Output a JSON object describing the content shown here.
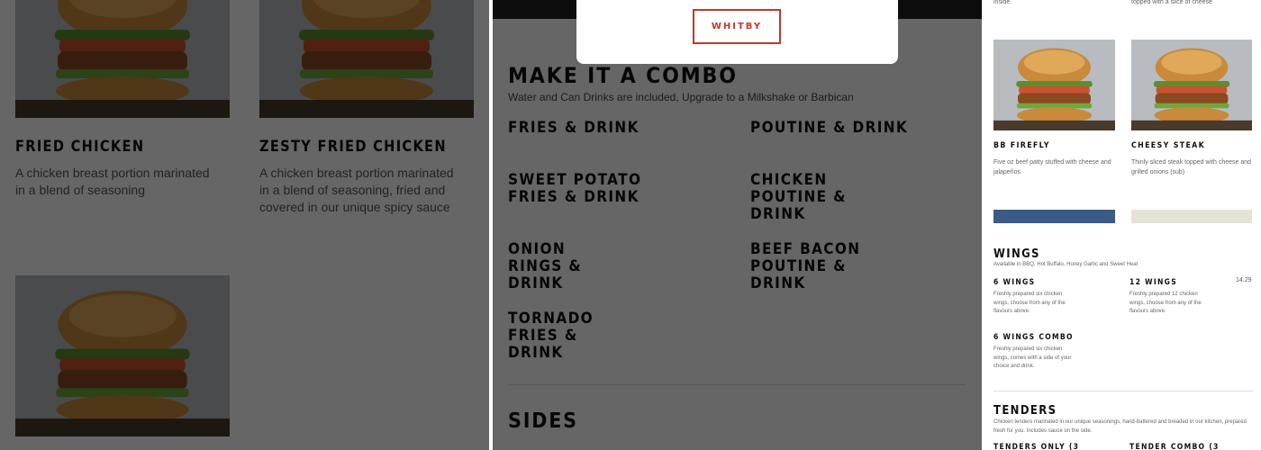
{
  "panel1": {
    "items": [
      {
        "title": "FRIED CHICKEN",
        "desc": "A chicken breast portion marinated in a blend of seasoning"
      },
      {
        "title": "ZESTY FRIED CHICKEN",
        "desc": "A chicken breast portion marinated in a blend of seasoning, fried and covered in our unique spicy sauce"
      }
    ]
  },
  "panel2": {
    "modal_button": "WHITBY",
    "combo_title": "MAKE IT A COMBO",
    "combo_subtitle": "Water and Can Drinks are included, Upgrade to a Milkshake or Barbican",
    "items": [
      "FRIES & DRINK",
      "POUTINE & DRINK",
      "SWEET POTATO FRIES & DRINK",
      "CHICKEN POUTINE & DRINK",
      "ONION RINGS & DRINK",
      "BEEF BACON POUTINE & DRINK",
      "TORNADO FRIES & DRINK"
    ],
    "sides_title": "SIDES"
  },
  "panel3": {
    "top_left_text": "inside",
    "top_right_text": "topped with a slice of cheese",
    "items": [
      {
        "title": "BB FIREFLY",
        "desc": "Five oz beef patty stuffed with cheese and jalapeños"
      },
      {
        "title": "CHEESY STEAK",
        "desc": "Thinly sliced steak topped with cheese and grilled onions (sub)"
      }
    ]
  },
  "panel4": {
    "wings_title": "WINGS",
    "wings_subtitle": "Available in BBQ, Hot Buffalo, Honey Garlic and Sweet Heat",
    "items": [
      {
        "title": "6 WINGS",
        "desc": "Freshly prepared six chicken wings, choose from any of the flavours above."
      },
      {
        "title": "12 WINGS",
        "desc": "Freshly prepared 12 chicken wings, choose from any of the flavours above.",
        "price": "14.29"
      },
      {
        "title": "6 WINGS COMBO",
        "desc": "Freshly prepared six chicken wings, comes with a side of your choice and drink."
      }
    ],
    "tenders_title": "TENDERS",
    "tenders_subtitle": "Chicken tenders marinated in our unique seasonings, hand-battered and breaded in our kitchen, prepared fresh for you. Includes sauce on the side.",
    "tenders_items": [
      "TENDERS ONLY (3",
      "TENDER COMBO (3"
    ]
  },
  "colors": {
    "accent": "#c0392b",
    "overlay": "rgba(0,0,0,0.6)"
  },
  "icons": [
    "fried-chicken-burger-image",
    "zesty-chicken-burger-image",
    "veggie-burger-image",
    "bb-firefly-image",
    "cheesy-steak-image"
  ]
}
